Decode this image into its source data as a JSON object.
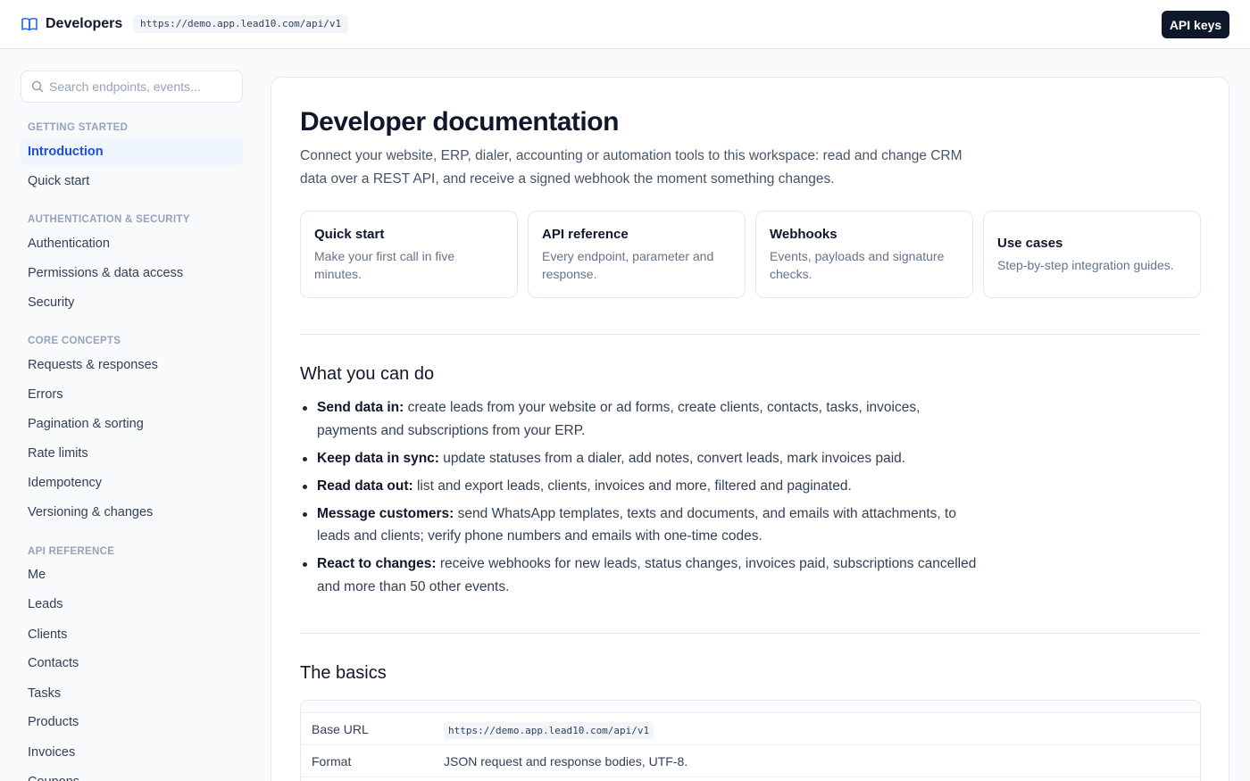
{
  "header": {
    "brand": "Developers",
    "base_url": "https://demo.app.lead10.com/api/v1",
    "api_keys_label": "API keys"
  },
  "sidebar": {
    "search_placeholder": "Search endpoints, events...",
    "sections": [
      {
        "title": "GETTING STARTED",
        "items": [
          {
            "label": "Introduction",
            "active": true
          },
          {
            "label": "Quick start"
          }
        ]
      },
      {
        "title": "AUTHENTICATION & SECURITY",
        "items": [
          {
            "label": "Authentication"
          },
          {
            "label": "Permissions & data access"
          },
          {
            "label": "Security"
          }
        ]
      },
      {
        "title": "CORE CONCEPTS",
        "items": [
          {
            "label": "Requests & responses"
          },
          {
            "label": "Errors"
          },
          {
            "label": "Pagination & sorting"
          },
          {
            "label": "Rate limits"
          },
          {
            "label": "Idempotency"
          },
          {
            "label": "Versioning & changes"
          }
        ]
      },
      {
        "title": "API REFERENCE",
        "items": [
          {
            "label": "Me"
          },
          {
            "label": "Leads"
          },
          {
            "label": "Clients"
          },
          {
            "label": "Contacts"
          },
          {
            "label": "Tasks"
          },
          {
            "label": "Products"
          },
          {
            "label": "Invoices"
          },
          {
            "label": "Coupons"
          }
        ]
      }
    ]
  },
  "main": {
    "title": "Developer documentation",
    "lead": "Connect your website, ERP, dialer, accounting or automation tools to this workspace: read and change CRM data over a REST API, and receive a signed webhook the moment something changes.",
    "cards": [
      {
        "title": "Quick start",
        "desc": "Make your first call in five minutes."
      },
      {
        "title": "API reference",
        "desc": "Every endpoint, parameter and response."
      },
      {
        "title": "Webhooks",
        "desc": "Events, payloads and signature checks."
      },
      {
        "title": "Use cases",
        "desc": "Step-by-step integration guides."
      }
    ],
    "what_title": "What you can do",
    "what_items": [
      {
        "label": "Send data in:",
        "text": " create leads from your website or ad forms, create clients, contacts, tasks, invoices, payments and subscriptions from your ERP."
      },
      {
        "label": "Keep data in sync:",
        "text": " update statuses from a dialer, add notes, convert leads, mark invoices paid."
      },
      {
        "label": "Read data out:",
        "text": " list and export leads, clients, invoices and more, filtered and paginated."
      },
      {
        "label": "Message customers:",
        "text": " send WhatsApp templates, texts and documents, and emails with attachments, to leads and clients; verify phone numbers and emails with one-time codes."
      },
      {
        "label": "React to changes:",
        "text": " receive webhooks for new leads, status changes, invoices paid, subscriptions cancelled and more than 50 other events."
      }
    ],
    "basics_title": "The basics",
    "basics_rows": [
      {
        "key": "Base URL",
        "value": "https://demo.app.lead10.com/api/v1",
        "code": true
      },
      {
        "key": "Format",
        "value": "JSON request and response bodies, UTF-8.",
        "code": false
      }
    ]
  }
}
